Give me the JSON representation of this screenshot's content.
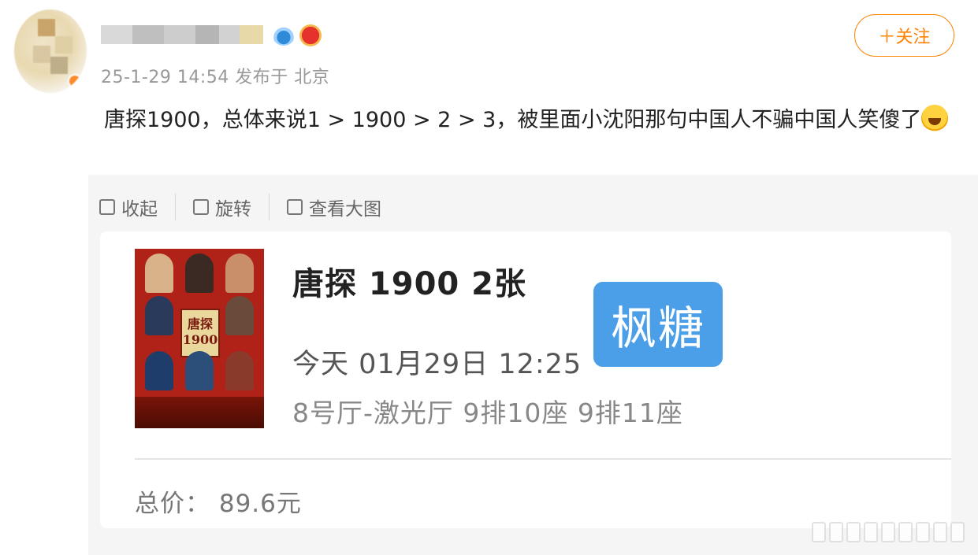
{
  "post": {
    "meta": "25-1-29 14:54 发布于 北京",
    "text": "唐探1900，总体来说1 > 1900 > 2 > 3，被里面小沈阳那句中国人不骗中国人笑傻了",
    "emoji": "laughing-crying-emoji"
  },
  "header": {
    "follow_label": "＋关注"
  },
  "toolbar": {
    "collapse_label": "收起",
    "rotate_label": "旋转",
    "view_large_label": "查看大图"
  },
  "ticket": {
    "movie_title": "唐探 1900 2张",
    "show_time": "今天 01月29日 12:25",
    "seats": "8号厅-激光厅 9排10座 9排11座",
    "brand": "枫糖",
    "total": "总价： 89.6元"
  },
  "poster": {
    "title_text": "唐探1900"
  },
  "colors": {
    "accent": "#ff8200",
    "brand_badge": "#4a9fe8",
    "media_bg": "#f5f5f5"
  }
}
